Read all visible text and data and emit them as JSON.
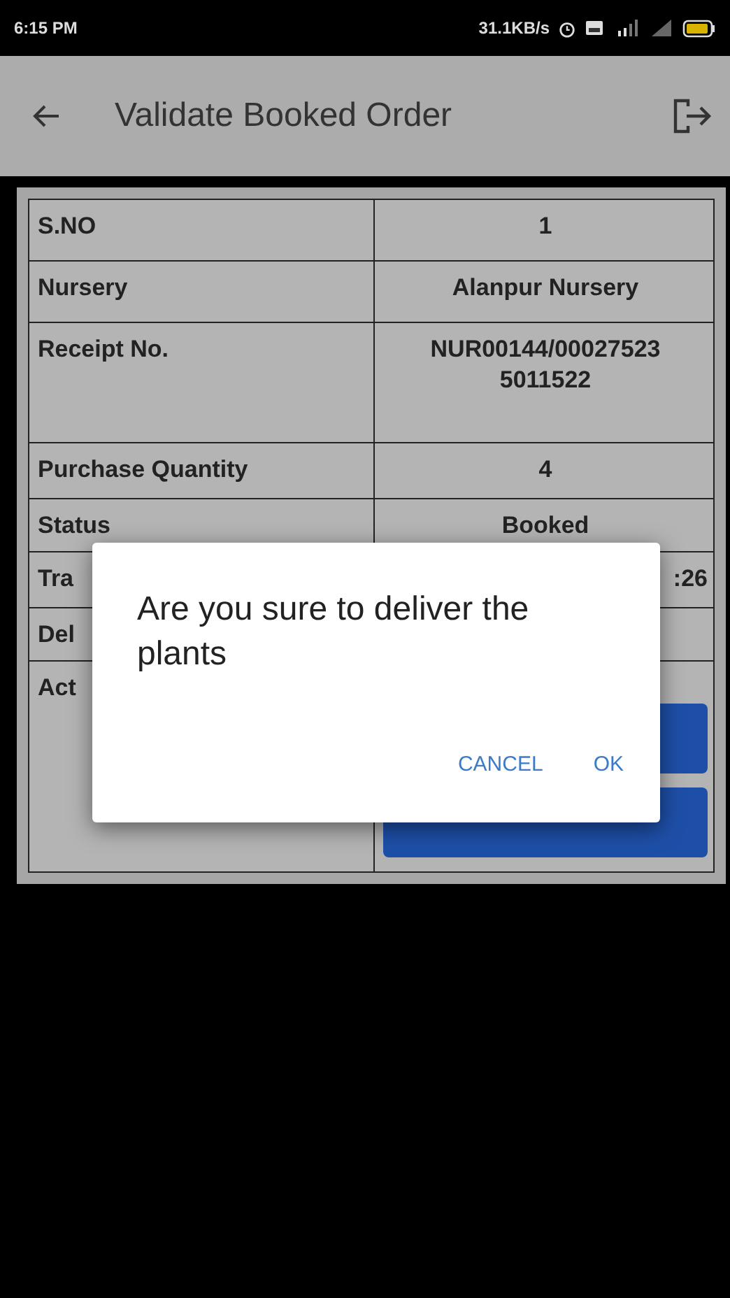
{
  "status_bar": {
    "time": "6:15 PM",
    "speed": "31.1KB/s"
  },
  "app_bar": {
    "title": "Validate Booked Order"
  },
  "table": {
    "rows": [
      {
        "label": "S.NO",
        "value": "1"
      },
      {
        "label": "Nursery",
        "value": "Alanpur Nursery"
      },
      {
        "label": "Receipt No.",
        "value": "NUR00144/00027523 5011522"
      },
      {
        "label": "Purchase Quantity",
        "value": "4"
      },
      {
        "label": "Status",
        "value": "Booked"
      },
      {
        "label": "Tra",
        "value": ":26"
      },
      {
        "label": "Del"
      },
      {
        "label": "Act",
        "kind": "actions"
      }
    ]
  },
  "dialog": {
    "message": "Are you sure to deliver the plants",
    "buttons": [
      "CANCEL",
      "OK"
    ]
  }
}
